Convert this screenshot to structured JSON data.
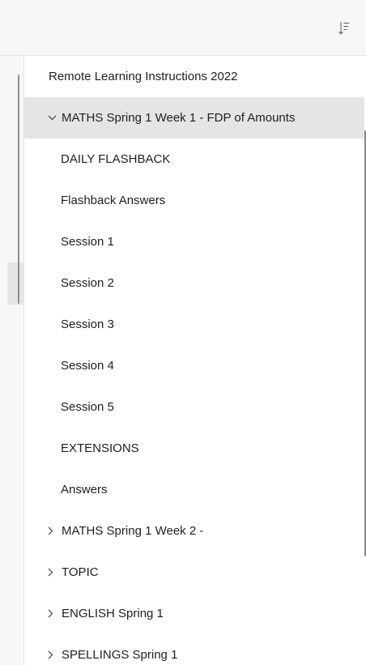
{
  "toolbar": {
    "sort_icon": "sort-icon"
  },
  "tree": {
    "items": [
      {
        "label": "Remote Learning Instructions 2022"
      },
      {
        "label": "MATHS Spring 1 Week 1 - FDP of Amounts",
        "expanded": true
      },
      {
        "label": "DAILY FLASHBACK"
      },
      {
        "label": "Flashback Answers"
      },
      {
        "label": "Session 1"
      },
      {
        "label": "Session 2"
      },
      {
        "label": "Session 3"
      },
      {
        "label": "Session 4"
      },
      {
        "label": "Session 5"
      },
      {
        "label": "EXTENSIONS"
      },
      {
        "label": "Answers"
      },
      {
        "label": "MATHS Spring 1 Week 2 -",
        "expanded": false
      },
      {
        "label": "TOPIC",
        "expanded": false
      },
      {
        "label": "ENGLISH Spring 1",
        "expanded": false
      },
      {
        "label": "SPELLINGS Spring 1",
        "expanded": false
      }
    ]
  },
  "colors": {
    "selected_bg": "#e5e5e5",
    "panel_bg": "#ffffff",
    "chrome_bg": "#f7f7f7"
  }
}
